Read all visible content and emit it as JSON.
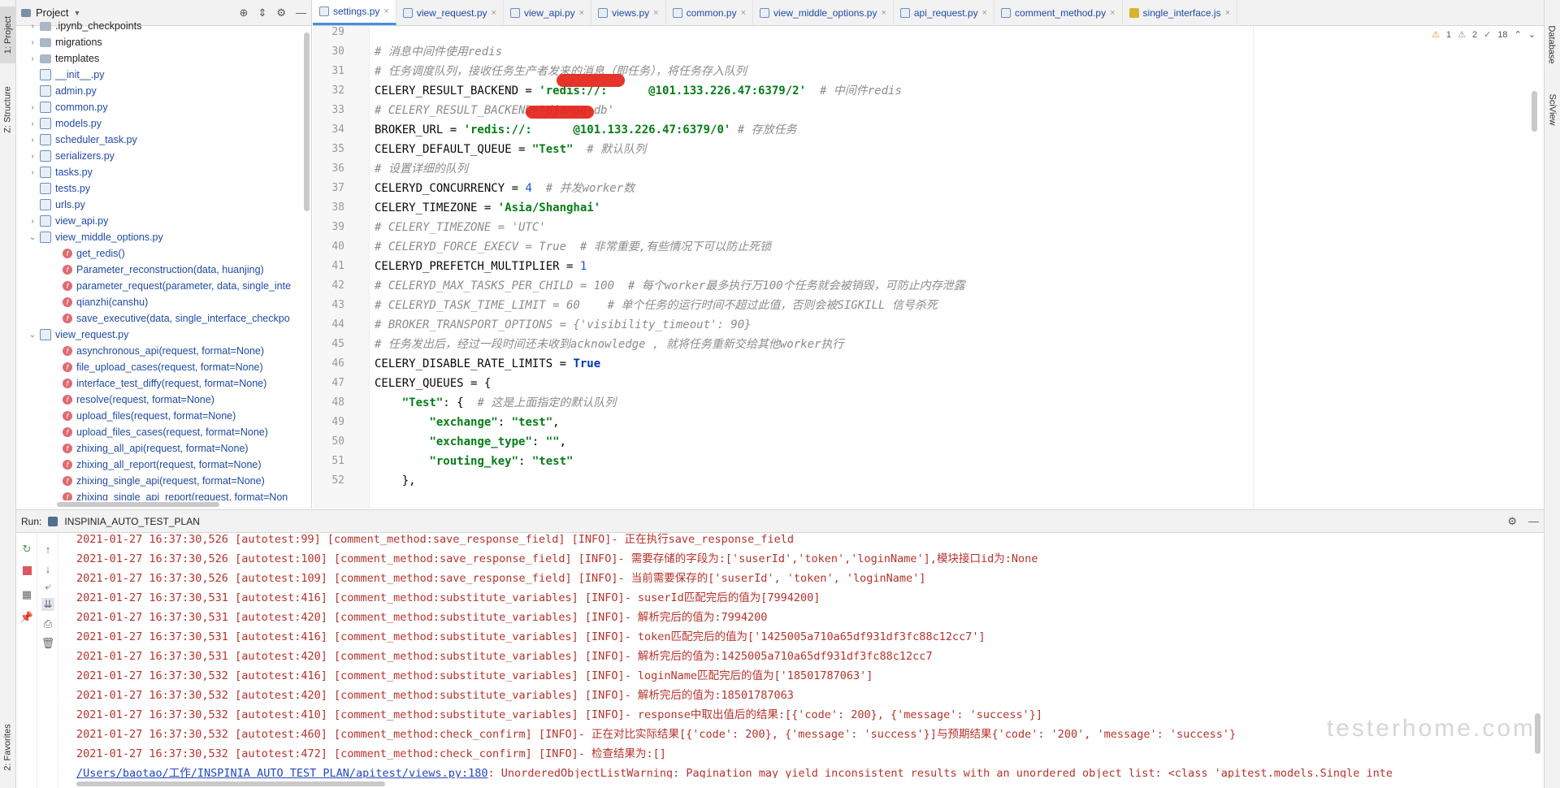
{
  "left_strip": {
    "project_tab": "1: Project",
    "structure_tab": "Z: Structure",
    "favorites_tab": "2: Favorites"
  },
  "right_strip": {
    "database_tab": "Database",
    "sciview_tab": "SciView"
  },
  "project_panel": {
    "title": "Project",
    "tree": [
      {
        "label": ".ipynb_checkpoints",
        "type": "folder",
        "indent": 1,
        "arrow": "right"
      },
      {
        "label": "migrations",
        "type": "folder",
        "indent": 1,
        "arrow": "right"
      },
      {
        "label": "templates",
        "type": "folder",
        "indent": 1,
        "arrow": "right"
      },
      {
        "label": "__init__.py",
        "type": "py",
        "indent": 1,
        "arrow": ""
      },
      {
        "label": "admin.py",
        "type": "py",
        "indent": 1,
        "arrow": ""
      },
      {
        "label": "common.py",
        "type": "py",
        "indent": 1,
        "arrow": "right"
      },
      {
        "label": "models.py",
        "type": "py",
        "indent": 1,
        "arrow": "right"
      },
      {
        "label": "scheduler_task.py",
        "type": "py",
        "indent": 1,
        "arrow": "right"
      },
      {
        "label": "serializers.py",
        "type": "py",
        "indent": 1,
        "arrow": "right"
      },
      {
        "label": "tasks.py",
        "type": "py",
        "indent": 1,
        "arrow": "right"
      },
      {
        "label": "tests.py",
        "type": "py",
        "indent": 1,
        "arrow": ""
      },
      {
        "label": "urls.py",
        "type": "py",
        "indent": 1,
        "arrow": ""
      },
      {
        "label": "view_api.py",
        "type": "py",
        "indent": 1,
        "arrow": "right"
      },
      {
        "label": "view_middle_options.py",
        "type": "py",
        "indent": 1,
        "arrow": "down"
      },
      {
        "label": "get_redis()",
        "type": "fn",
        "indent": 2,
        "arrow": ""
      },
      {
        "label": "Parameter_reconstruction(data, huanjing)",
        "type": "fn",
        "indent": 2,
        "arrow": ""
      },
      {
        "label": "parameter_request(parameter, data, single_inte",
        "type": "fn",
        "indent": 2,
        "arrow": ""
      },
      {
        "label": "qianzhi(canshu)",
        "type": "fn",
        "indent": 2,
        "arrow": ""
      },
      {
        "label": "save_executive(data, single_interface_checkpo",
        "type": "fn",
        "indent": 2,
        "arrow": ""
      },
      {
        "label": "view_request.py",
        "type": "py",
        "indent": 1,
        "arrow": "down"
      },
      {
        "label": "asynchronous_api(request, format=None)",
        "type": "fn",
        "indent": 2,
        "arrow": ""
      },
      {
        "label": "file_upload_cases(request, format=None)",
        "type": "fn",
        "indent": 2,
        "arrow": ""
      },
      {
        "label": "interface_test_diffy(request, format=None)",
        "type": "fn",
        "indent": 2,
        "arrow": ""
      },
      {
        "label": "resolve(request, format=None)",
        "type": "fn",
        "indent": 2,
        "arrow": ""
      },
      {
        "label": "upload_files(request, format=None)",
        "type": "fn",
        "indent": 2,
        "arrow": ""
      },
      {
        "label": "upload_files_cases(request, format=None)",
        "type": "fn",
        "indent": 2,
        "arrow": ""
      },
      {
        "label": "zhixing_all_api(request, format=None)",
        "type": "fn",
        "indent": 2,
        "arrow": ""
      },
      {
        "label": "zhixing_all_report(request, format=None)",
        "type": "fn",
        "indent": 2,
        "arrow": ""
      },
      {
        "label": "zhixing_single_api(request, format=None)",
        "type": "fn",
        "indent": 2,
        "arrow": ""
      },
      {
        "label": "zhixing_single_api_report(request, format=Non",
        "type": "fn",
        "indent": 2,
        "arrow": ""
      }
    ]
  },
  "editor_tabs": [
    {
      "label": "settings.py",
      "active": true,
      "kind": "py"
    },
    {
      "label": "view_request.py",
      "active": false,
      "kind": "py"
    },
    {
      "label": "view_api.py",
      "active": false,
      "kind": "py"
    },
    {
      "label": "views.py",
      "active": false,
      "kind": "py"
    },
    {
      "label": "common.py",
      "active": false,
      "kind": "py"
    },
    {
      "label": "view_middle_options.py",
      "active": false,
      "kind": "py"
    },
    {
      "label": "api_request.py",
      "active": false,
      "kind": "py"
    },
    {
      "label": "comment_method.py",
      "active": false,
      "kind": "py"
    },
    {
      "label": "single_interface.js",
      "active": false,
      "kind": "js"
    }
  ],
  "inspections": {
    "warnings": "1",
    "weak_warnings": "2",
    "typos": "18"
  },
  "code_lines": [
    {
      "n": "29",
      "indent": "",
      "tokens": []
    },
    {
      "n": "30",
      "indent": "",
      "tokens": [
        {
          "c": "cm",
          "t": "# 消息中间件使用redis"
        }
      ]
    },
    {
      "n": "31",
      "indent": "",
      "tokens": [
        {
          "c": "cm",
          "t": "# 任务调度队列，接收任务生产者发来的消息（即任务），将任务存入队列"
        }
      ]
    },
    {
      "n": "32",
      "indent": "",
      "tokens": [
        {
          "c": "tx",
          "t": "CELERY_RESULT_BACKEND = "
        },
        {
          "c": "st",
          "t": "'redis://:      @101.133.226.47:6379/2'"
        },
        {
          "c": "cm",
          "t": "  # 中间件redis"
        }
      ]
    },
    {
      "n": "33",
      "indent": "",
      "tokens": [
        {
          "c": "cm",
          "t": "# CELERY_RESULT_BACKEND='django-db'"
        }
      ]
    },
    {
      "n": "34",
      "indent": "",
      "tokens": [
        {
          "c": "tx",
          "t": "BROKER_URL = "
        },
        {
          "c": "st",
          "t": "'redis://:      @101.133.226.47:6379/0'"
        },
        {
          "c": "cm",
          "t": " # 存放任务"
        }
      ]
    },
    {
      "n": "35",
      "indent": "",
      "tokens": [
        {
          "c": "tx",
          "t": "CELERY_DEFAULT_QUEUE = "
        },
        {
          "c": "st",
          "t": "\"Test\""
        },
        {
          "c": "cm",
          "t": "  # 默认队列"
        }
      ]
    },
    {
      "n": "36",
      "indent": "",
      "tokens": [
        {
          "c": "cm",
          "t": "# 设置详细的队列"
        }
      ]
    },
    {
      "n": "37",
      "indent": "",
      "tokens": [
        {
          "c": "tx",
          "t": "CELERYD_CONCURRENCY = "
        },
        {
          "c": "nm",
          "t": "4"
        },
        {
          "c": "cm",
          "t": "  # 并发worker数"
        }
      ]
    },
    {
      "n": "38",
      "indent": "",
      "tokens": [
        {
          "c": "tx",
          "t": "CELERY_TIMEZONE = "
        },
        {
          "c": "st",
          "t": "'Asia/Shanghai'"
        }
      ]
    },
    {
      "n": "39",
      "indent": "",
      "tokens": [
        {
          "c": "cm",
          "t": "# CELERY_TIMEZONE = 'UTC'"
        }
      ]
    },
    {
      "n": "40",
      "indent": "",
      "tokens": [
        {
          "c": "cm",
          "t": "# CELERYD_FORCE_EXECV = True  # 非常重要,有些情况下可以防止死锁"
        }
      ]
    },
    {
      "n": "41",
      "indent": "",
      "tokens": [
        {
          "c": "tx",
          "t": "CELERYD_PREFETCH_MULTIPLIER = "
        },
        {
          "c": "nm",
          "t": "1"
        }
      ]
    },
    {
      "n": "42",
      "indent": "",
      "tokens": [
        {
          "c": "cm",
          "t": "# CELERYD_MAX_TASKS_PER_CHILD = 100  # 每个worker最多执行万100个任务就会被销毁，可防止内存泄露"
        }
      ]
    },
    {
      "n": "43",
      "indent": "",
      "tokens": [
        {
          "c": "cm",
          "t": "# CELERYD_TASK_TIME_LIMIT = 60    # 单个任务的运行时间不超过此值，否则会被SIGKILL 信号杀死"
        }
      ]
    },
    {
      "n": "44",
      "indent": "",
      "tokens": [
        {
          "c": "cm",
          "t": "# BROKER_TRANSPORT_OPTIONS = {'visibility_timeout': 90}"
        }
      ]
    },
    {
      "n": "45",
      "indent": "",
      "tokens": [
        {
          "c": "cm",
          "t": "# 任务发出后，经过一段时间还未收到acknowledge , 就将任务重新交给其他worker执行"
        }
      ]
    },
    {
      "n": "46",
      "indent": "",
      "tokens": [
        {
          "c": "tx",
          "t": "CELERY_DISABLE_RATE_LIMITS = "
        },
        {
          "c": "kw",
          "t": "True"
        }
      ]
    },
    {
      "n": "47",
      "indent": "",
      "tokens": [
        {
          "c": "tx",
          "t": "CELERY_QUEUES = {"
        }
      ]
    },
    {
      "n": "48",
      "indent": "    ",
      "tokens": [
        {
          "c": "st",
          "t": "\"Test\""
        },
        {
          "c": "tx",
          "t": ": {  "
        },
        {
          "c": "cm",
          "t": "# 这是上面指定的默认队列"
        }
      ]
    },
    {
      "n": "49",
      "indent": "        ",
      "tokens": [
        {
          "c": "st",
          "t": "\"exchange\""
        },
        {
          "c": "tx",
          "t": ": "
        },
        {
          "c": "st",
          "t": "\"test\""
        },
        {
          "c": "tx",
          "t": ","
        }
      ]
    },
    {
      "n": "50",
      "indent": "        ",
      "tokens": [
        {
          "c": "st",
          "t": "\"exchange_type\""
        },
        {
          "c": "tx",
          "t": ": "
        },
        {
          "c": "st",
          "t": "\"\""
        },
        {
          "c": "tx",
          "t": ","
        }
      ]
    },
    {
      "n": "51",
      "indent": "        ",
      "tokens": [
        {
          "c": "st",
          "t": "\"routing_key\""
        },
        {
          "c": "tx",
          "t": ": "
        },
        {
          "c": "st",
          "t": "\"test\""
        }
      ]
    },
    {
      "n": "52",
      "indent": "    ",
      "tokens": [
        {
          "c": "tx",
          "t": "},"
        }
      ]
    }
  ],
  "run_panel": {
    "label": "Run:",
    "config_name": "INSPINIA_AUTO_TEST_PLAN",
    "log_lines": [
      "2021-01-27 16:37:30,526 [autotest:99] [comment_method:save_response_field] [INFO]- 正在执行save_response_field",
      "2021-01-27 16:37:30,526 [autotest:100] [comment_method:save_response_field] [INFO]- 需要存储的字段为:['suserId','token','loginName'],模块接口id为:None",
      "2021-01-27 16:37:30,526 [autotest:109] [comment_method:save_response_field] [INFO]- 当前需要保存的['suserId', 'token', 'loginName']",
      "2021-01-27 16:37:30,531 [autotest:416] [comment_method:substitute_variables] [INFO]- suserId匹配完后的值为[7994200]",
      "2021-01-27 16:37:30,531 [autotest:420] [comment_method:substitute_variables] [INFO]- 解析完后的值为:7994200",
      "2021-01-27 16:37:30,531 [autotest:416] [comment_method:substitute_variables] [INFO]- token匹配完后的值为['1425005a710a65df931df3fc88c12cc7']",
      "2021-01-27 16:37:30,531 [autotest:420] [comment_method:substitute_variables] [INFO]- 解析完后的值为:1425005a710a65df931df3fc88c12cc7",
      "2021-01-27 16:37:30,532 [autotest:416] [comment_method:substitute_variables] [INFO]- loginName匹配完后的值为['18501787063']",
      "2021-01-27 16:37:30,532 [autotest:420] [comment_method:substitute_variables] [INFO]- 解析完后的值为:18501787063",
      "2021-01-27 16:37:30,532 [autotest:410] [comment_method:substitute_variables] [INFO]- response中取出值后的结果:[{'code': 200}, {'message': 'success'}]",
      "2021-01-27 16:37:30,532 [autotest:460] [comment_method:check_confirm] [INFO]- 正在对比实际结果[{'code': 200}, {'message': 'success'}]与预期结果{'code': '200', 'message': 'success'}",
      "2021-01-27 16:37:30,532 [autotest:472] [comment_method:check_confirm] [INFO]- 检查结果为:[]"
    ],
    "warning_link": "/Users/baotao/工作/INSPINIA_AUTO_TEST_PLAN/apitest/views.py:180",
    "warning_text": ": UnorderedObjectListWarning: Pagination may yield inconsistent results with an unordered object list: <class 'apitest.models.Single_inte"
  },
  "watermark": "testerhome.com"
}
